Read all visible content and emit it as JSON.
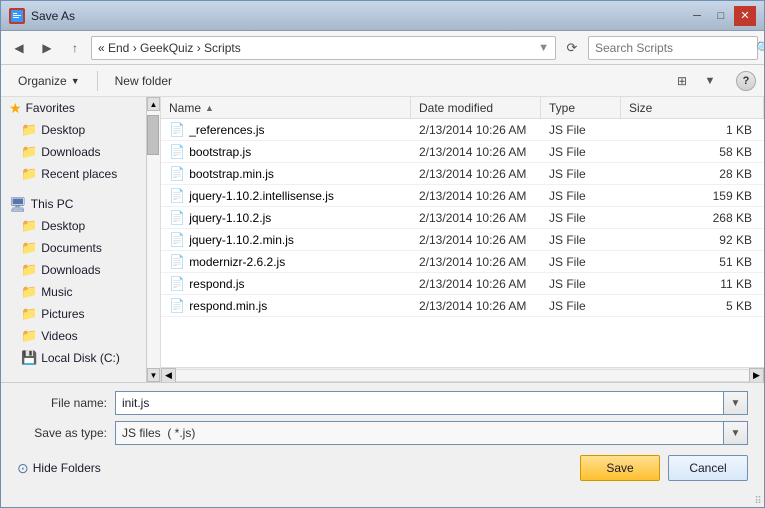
{
  "window": {
    "title": "Save As"
  },
  "titlebar": {
    "title": "Save As",
    "min_label": "─",
    "max_label": "□",
    "close_label": "✕"
  },
  "addressbar": {
    "back_disabled": false,
    "forward_disabled": false,
    "up_label": "↑",
    "breadcrumb": "« End  ›  GeekQuiz  ›  Scripts",
    "search_placeholder": "Search Scripts",
    "refresh_label": "⟳"
  },
  "toolbar": {
    "organize_label": "Organize",
    "new_folder_label": "New folder",
    "view_label": "⊞",
    "view2_label": "▼",
    "help_label": "?"
  },
  "nav": {
    "favorites_label": "Favorites",
    "favorites_items": [
      {
        "label": "Desktop",
        "icon": "📁"
      },
      {
        "label": "Downloads",
        "icon": "📁"
      },
      {
        "label": "Recent places",
        "icon": "📁"
      }
    ],
    "this_pc_label": "This PC",
    "this_pc_items": [
      {
        "label": "Desktop",
        "icon": "📁"
      },
      {
        "label": "Documents",
        "icon": "📁"
      },
      {
        "label": "Downloads",
        "icon": "📁"
      },
      {
        "label": "Music",
        "icon": "📁"
      },
      {
        "label": "Pictures",
        "icon": "📁"
      },
      {
        "label": "Videos",
        "icon": "📁"
      },
      {
        "label": "Local Disk (C:)",
        "icon": "💾"
      }
    ]
  },
  "file_list": {
    "columns": {
      "name": "Name",
      "date_modified": "Date modified",
      "type": "Type",
      "size": "Size"
    },
    "sort_indicator": "▲",
    "files": [
      {
        "name": "_references.js",
        "date": "2/13/2014 10:26 AM",
        "type": "JS File",
        "size": "1 KB"
      },
      {
        "name": "bootstrap.js",
        "date": "2/13/2014 10:26 AM",
        "type": "JS File",
        "size": "58 KB"
      },
      {
        "name": "bootstrap.min.js",
        "date": "2/13/2014 10:26 AM",
        "type": "JS File",
        "size": "28 KB"
      },
      {
        "name": "jquery-1.10.2.intellisense.js",
        "date": "2/13/2014 10:26 AM",
        "type": "JS File",
        "size": "159 KB"
      },
      {
        "name": "jquery-1.10.2.js",
        "date": "2/13/2014 10:26 AM",
        "type": "JS File",
        "size": "268 KB"
      },
      {
        "name": "jquery-1.10.2.min.js",
        "date": "2/13/2014 10:26 AM",
        "type": "JS File",
        "size": "92 KB"
      },
      {
        "name": "modernizr-2.6.2.js",
        "date": "2/13/2014 10:26 AM",
        "type": "JS File",
        "size": "51 KB"
      },
      {
        "name": "respond.js",
        "date": "2/13/2014 10:26 AM",
        "type": "JS File",
        "size": "11 KB"
      },
      {
        "name": "respond.min.js",
        "date": "2/13/2014 10:26 AM",
        "type": "JS File",
        "size": "5 KB"
      }
    ]
  },
  "form": {
    "filename_label": "File name:",
    "filename_value": "init.js",
    "savetype_label": "Save as type:",
    "savetype_value": "JS files  ( *.js)"
  },
  "actions": {
    "hide_folders_label": "Hide Folders",
    "save_label": "Save",
    "cancel_label": "Cancel"
  }
}
